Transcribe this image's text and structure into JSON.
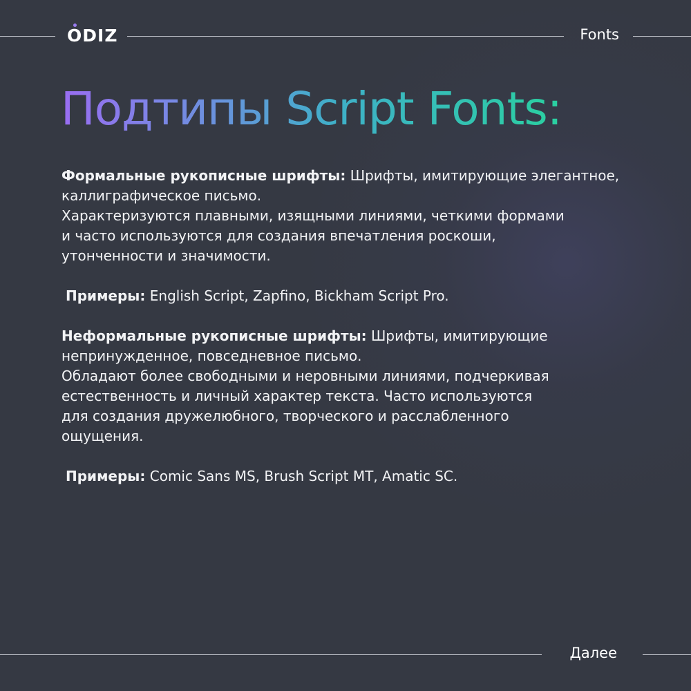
{
  "header": {
    "logo_prefix": "O",
    "logo_suffix": "DIZ",
    "label": "Fonts"
  },
  "title": "Подтипы Script Fonts:",
  "sections": [
    {
      "heading": "Формальные рукописные шрифты:",
      "lines": [
        "Шрифты, имитирующие элегантное,",
        "каллиграфическое письмо.",
        "Характеризуются плавными, изящными линиями, четкими формами",
        "и часто используются для создания впечатления роскоши,",
        "утонченности и значимости."
      ],
      "examples_label": "Примеры:",
      "examples": "English Script, Zapfino, Bickham Script Pro."
    },
    {
      "heading": "Неформальные рукописные шрифты:",
      "lines": [
        "Шрифты, имитирующие",
        "непринужденное, повседневное письмо.",
        "Обладают более свободными и неровными линиями, подчеркивая",
        "естественность и личный характер текста. Часто используются",
        "для создания дружелюбного, творческого и расслабленного",
        "ощущения."
      ],
      "examples_label": "Примеры:",
      "examples": "Comic Sans MS, Brush Script MT, Amatic SC."
    }
  ],
  "footer": {
    "next_label": "Далее"
  },
  "colors": {
    "background": "#353943",
    "title_gradient_start": "#9a6df2",
    "title_gradient_end": "#2ad0a0",
    "logo_dot": "#9b7df0"
  }
}
